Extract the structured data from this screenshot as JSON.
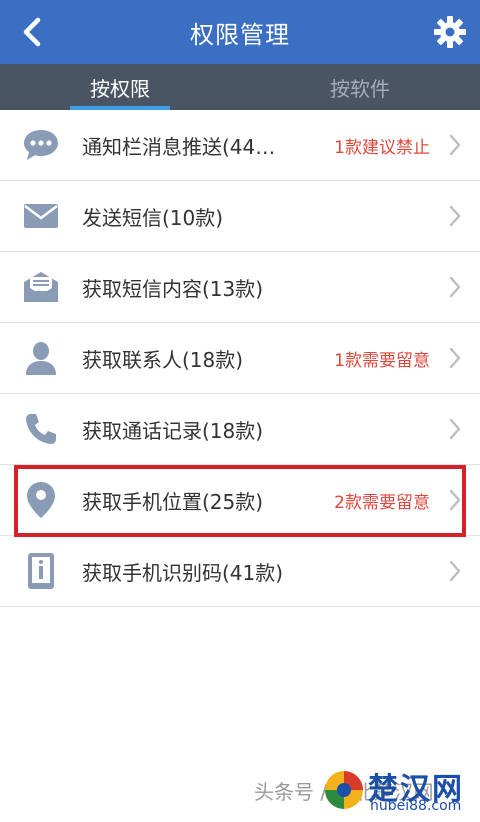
{
  "header": {
    "title": "权限管理",
    "back_icon": "chevron-left-icon",
    "settings_icon": "gear-icon"
  },
  "tabs": [
    {
      "label": "按权限",
      "active": true
    },
    {
      "label": "按软件",
      "active": false
    }
  ],
  "permissions": [
    {
      "label": "通知栏消息推送(44…",
      "note": "1款建议禁止",
      "icon": "chat-bubble-icon"
    },
    {
      "label": "发送短信(10款)",
      "note": "",
      "icon": "envelope-icon"
    },
    {
      "label": "获取短信内容(13款)",
      "note": "",
      "icon": "open-envelope-icon"
    },
    {
      "label": "获取联系人(18款)",
      "note": "1款需要留意",
      "icon": "person-icon"
    },
    {
      "label": "获取通话记录(18款)",
      "note": "",
      "icon": "phone-icon"
    },
    {
      "label": "获取手机位置(25款)",
      "note": "2款需要留意",
      "icon": "location-pin-icon"
    },
    {
      "label": "获取手机识别码(41款)",
      "note": "",
      "icon": "device-info-icon"
    }
  ],
  "colors": {
    "header_bg": "#3a6fc4",
    "tab_bg": "#4a5563",
    "tab_indicator": "#3fa0e8",
    "warning_text": "#e0473b",
    "highlight_border": "#d3222a",
    "icon_color": "#8a9bb5"
  },
  "watermark": {
    "text": "头条号 / 湖北楚汉网",
    "brand": "楚汉网",
    "url": "hubei88.com"
  }
}
